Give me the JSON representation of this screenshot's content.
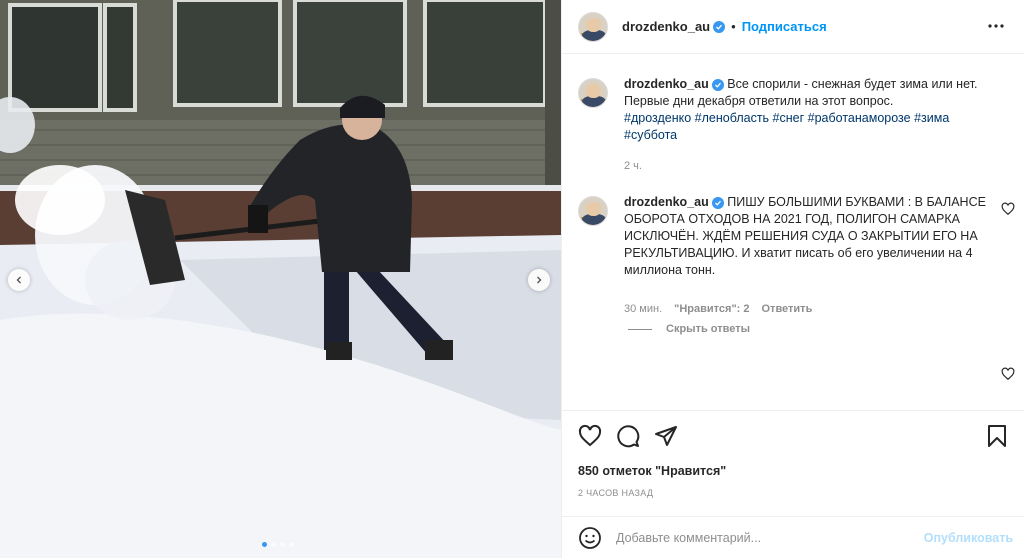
{
  "post": {
    "author": "drozdenko_au",
    "follow_label": "Подписаться",
    "separator": "•",
    "likes": "850 отметок \"Нравится\"",
    "posted_ago": "2 ЧАСОВ НАЗАД"
  },
  "caption": {
    "author": "drozdenko_au",
    "text": "Все спорили - снежная будет зима или нет. Первые дни декабря ответили на этот вопрос.",
    "hashtags": [
      "#дрозденко",
      "#ленобласть",
      "#снег",
      "#работанаморозе",
      "#зима",
      "#суббота"
    ],
    "time": "2 ч."
  },
  "comment": {
    "author": "drozdenko_au",
    "text": "ПИШУ БОЛЬШИМИ БУКВАМИ : В БАЛАНСЕ ОБОРОТА ОТХОДОВ НА 2021 ГОД, ПОЛИГОН САМАРКА ИСКЛЮЧЁН. ЖДЁМ РЕШЕНИЯ СУДА О ЗАКРЫТИИ ЕГО НА РЕКУЛЬТИВАЦИЮ. И хватит писать об его увеличении на 4 миллиона тонн.",
    "time": "30 мин.",
    "likes": "\"Нравится\": 2",
    "reply": "Ответить",
    "hide_replies": "Скрыть ответы"
  },
  "composer": {
    "placeholder": "Добавьте комментарий...",
    "publish": "Опубликовать"
  },
  "carousel": {
    "slides": 4,
    "active_index": 0
  },
  "colors": {
    "accent": "#0095f6",
    "hashtag": "#00376b",
    "muted": "#8e8e8e"
  },
  "icons": [
    "chevron-left-icon",
    "chevron-right-icon",
    "verified-icon",
    "more-icon",
    "heart-icon",
    "comment-icon",
    "share-icon",
    "bookmark-icon",
    "emoji-icon"
  ]
}
